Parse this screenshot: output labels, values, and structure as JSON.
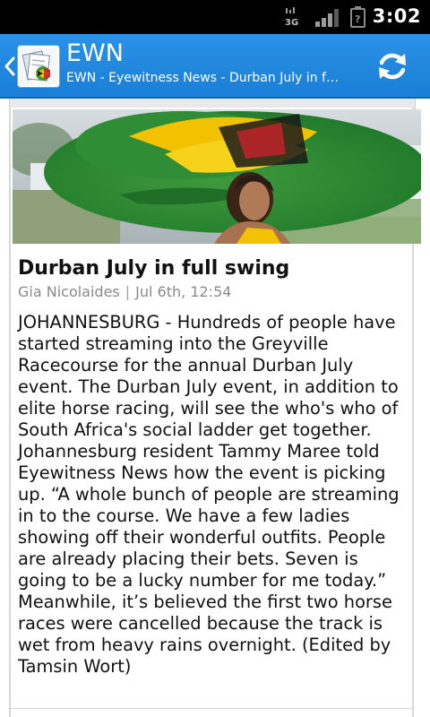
{
  "status_bar": {
    "network_label": "3G",
    "time": "3:02",
    "icons": [
      "3g-signal-icon",
      "cell-signal-icon",
      "battery-icon"
    ]
  },
  "action_bar": {
    "title": "EWN",
    "subtitle": "EWN - Eyewitness News - Durban July in fu...",
    "icons": [
      "back-chevron-icon",
      "app-logo-icon",
      "refresh-icon"
    ],
    "colors": {
      "bar": "#1e88e0",
      "text": "#ffffff"
    }
  },
  "article": {
    "image_alt": "woman-in-large-green-yellow-hat-image",
    "title": "Durban July in full swing",
    "author": "Gia Nicolaides",
    "date": "Jul 6th, 12:54",
    "body": "JOHANNESBURG - Hundreds of people have started streaming into the Greyville Racecourse for the annual Durban July event.  The Durban July event, in addition to elite horse racing, will see the who's who of South Africa's social ladder get together. Johannesburg resident Tammy Maree told Eyewitness News how the event is picking up.  “A whole bunch of people are streaming in to the course. We have a few ladies showing off their wonderful outfits. People are already placing their bets. Seven is going to be a lucky number for me today.” Meanwhile, it’s believed the first two horse races were cancelled because the track is wet from heavy rains overnight. (Edited by Tamsin Wort)"
  }
}
